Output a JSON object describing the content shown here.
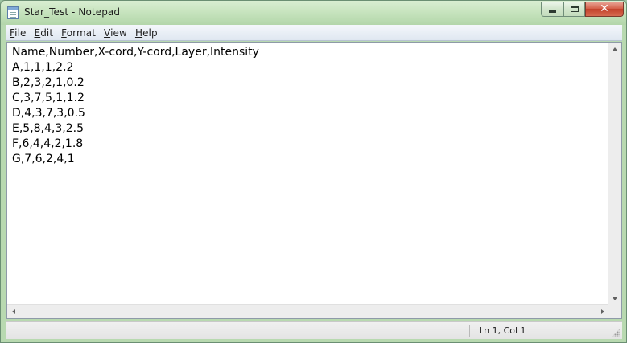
{
  "window": {
    "title": "Star_Test - Notepad",
    "icon": "notepad-icon",
    "controls": {
      "minimize_icon": "minimize-icon",
      "maximize_icon": "maximize-icon",
      "close_icon": "close-icon",
      "close_glyph": "✕"
    }
  },
  "menu": {
    "items": [
      {
        "accel": "F",
        "rest": "ile"
      },
      {
        "accel": "E",
        "rest": "dit"
      },
      {
        "accel": "F",
        "rest": "ormat"
      },
      {
        "accel": "V",
        "rest": "iew"
      },
      {
        "accel": "H",
        "rest": "elp"
      }
    ]
  },
  "document": {
    "lines": [
      "Name,Number,X-cord,Y-cord,Layer,Intensity",
      "A,1,1,1,2,2",
      "B,2,3,2,1,0.2",
      "C,3,7,5,1,1.2",
      "D,4,3,7,3,0.5",
      "E,5,8,4,3,2.5",
      "F,6,4,4,2,1.8",
      "G,7,6,2,4,1"
    ]
  },
  "status": {
    "position": "Ln 1, Col 1"
  },
  "colors": {
    "close_button": "#c2412a",
    "menubar": "#dfe7f1",
    "editor_bg": "#ffffff"
  }
}
